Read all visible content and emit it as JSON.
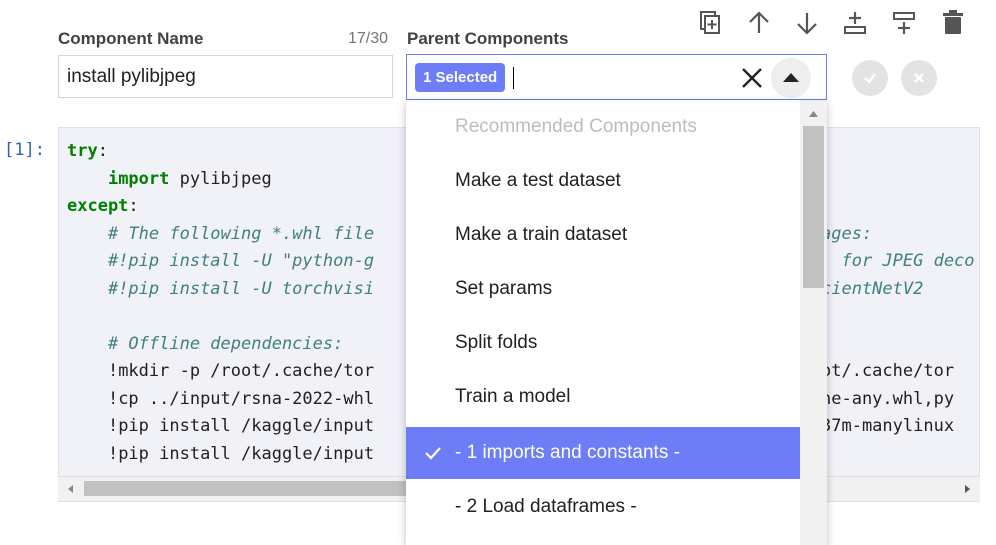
{
  "form": {
    "component_name_label": "Component Name",
    "char_counter": "17/30",
    "component_name_value": "install pylibjpeg",
    "parent_components_label": "Parent Components",
    "selected_chip": "1 Selected"
  },
  "cell": {
    "prompt": "[1]:",
    "lines": {
      "l1_kw": "try",
      "l1_rest": ":",
      "l2_kw": "import",
      "l2_rest": " pylibjpeg",
      "l3_kw": "except",
      "l3_rest": ":",
      "l4": "# The following *.whl file",
      "l4b": "ages:",
      "l5": "#!pip install -U \"python-g",
      "l5b": "' for JPEG deco",
      "l6": "#!pip install -U torchvisi",
      "l6b": "cientNetV2",
      "l8": "# Offline dependencies:",
      "l9a": "!mkdir -p /root/.cache/tor",
      "l10a": "!cp ../input/rsna-2022-whl",
      "l10b": "ot/.cache/tor",
      "l11a": "!pip install /kaggle/input",
      "l11b": "ne-any.whl,py",
      "l12a": "!pip install /kaggle/input",
      "l12b": "37m-manylinux"
    }
  },
  "dropdown": {
    "header": "Recommended Components",
    "items": [
      "Make a test dataset",
      "Make a train dataset",
      "Set params",
      "Split folds",
      "Train a model",
      "- 1 imports and constants -",
      "- 2 Load dataframes -"
    ],
    "selected_index": 5
  },
  "colors": {
    "accent": "#6c7df6",
    "code_bg": "#f1f1f8",
    "keyword": "#008000",
    "comment": "#408080"
  },
  "icons": {
    "toolbar": [
      "duplicate-icon",
      "arrow-up-icon",
      "arrow-down-icon",
      "insert-below-icon",
      "insert-above-icon",
      "trash-icon"
    ],
    "parent_box": [
      "clear-x-icon",
      "chevron-up-icon"
    ],
    "actions": [
      "confirm-check-icon",
      "cancel-x-icon"
    ]
  }
}
